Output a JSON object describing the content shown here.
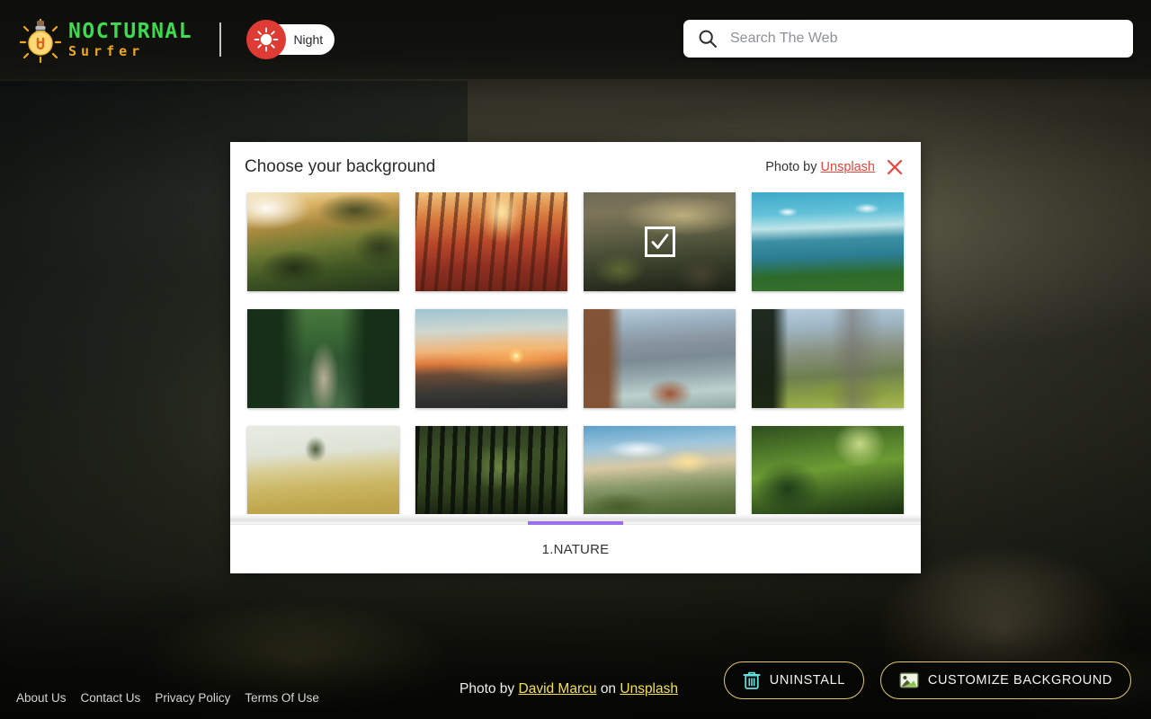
{
  "brand": {
    "name_main": "NOCTURNAL",
    "name_sub": "Surfer",
    "logo_icon": "lightbulb-icon",
    "color_main": "#3ddb4d",
    "color_sub": "#f0a818"
  },
  "mode_toggle": {
    "label": "Night",
    "icon": "sun-icon",
    "knob_color": "#dd3b34"
  },
  "search": {
    "placeholder": "Search The Web",
    "value": "",
    "icon": "search-icon"
  },
  "modal": {
    "title": "Choose your background",
    "credit_prefix": "Photo by",
    "credit_link": "Unsplash",
    "close_icon": "close-icon",
    "close_color": "#e8453c",
    "selected_index": 2,
    "check_icon": "checkmark-icon",
    "tab": {
      "label": "1.NATURE",
      "underline_color": "#9b6fe8"
    },
    "thumbnails": [
      {
        "alt": "sunlit green forest valley with tree"
      },
      {
        "alt": "autumn forest with sun rays"
      },
      {
        "alt": "misty mountain ridge with rocky peaks"
      },
      {
        "alt": "blue lake with boat and forested shore"
      },
      {
        "alt": "wooden footbridge through green forest"
      },
      {
        "alt": "orange sunset over layered mountains"
      },
      {
        "alt": "alpine lake with boathouse and rowboats"
      },
      {
        "alt": "granite cliff and pine meadow valley"
      },
      {
        "alt": "lone tree in golden wheat field"
      },
      {
        "alt": "tall dark pine tree trunks forest"
      },
      {
        "alt": "grassy cliff ridge under sunset clouds"
      },
      {
        "alt": "lush green jungle canopy with light rays"
      }
    ]
  },
  "footer": {
    "links": [
      {
        "label": "About Us"
      },
      {
        "label": "Contact Us"
      },
      {
        "label": "Privacy Policy"
      },
      {
        "label": "Terms Of Use"
      }
    ],
    "photo_credit": {
      "prefix": "Photo by",
      "author": "David Marcu",
      "middle": "on",
      "source": "Unsplash",
      "link_color": "#f5e14b"
    },
    "buttons": [
      {
        "label": "UNINSTALL",
        "icon": "trash-icon",
        "icon_color": "#62e0e0"
      },
      {
        "label": "CUSTOMIZE BACKGROUND",
        "icon": "image-icon",
        "icon_color": "#8bc34a"
      }
    ]
  }
}
